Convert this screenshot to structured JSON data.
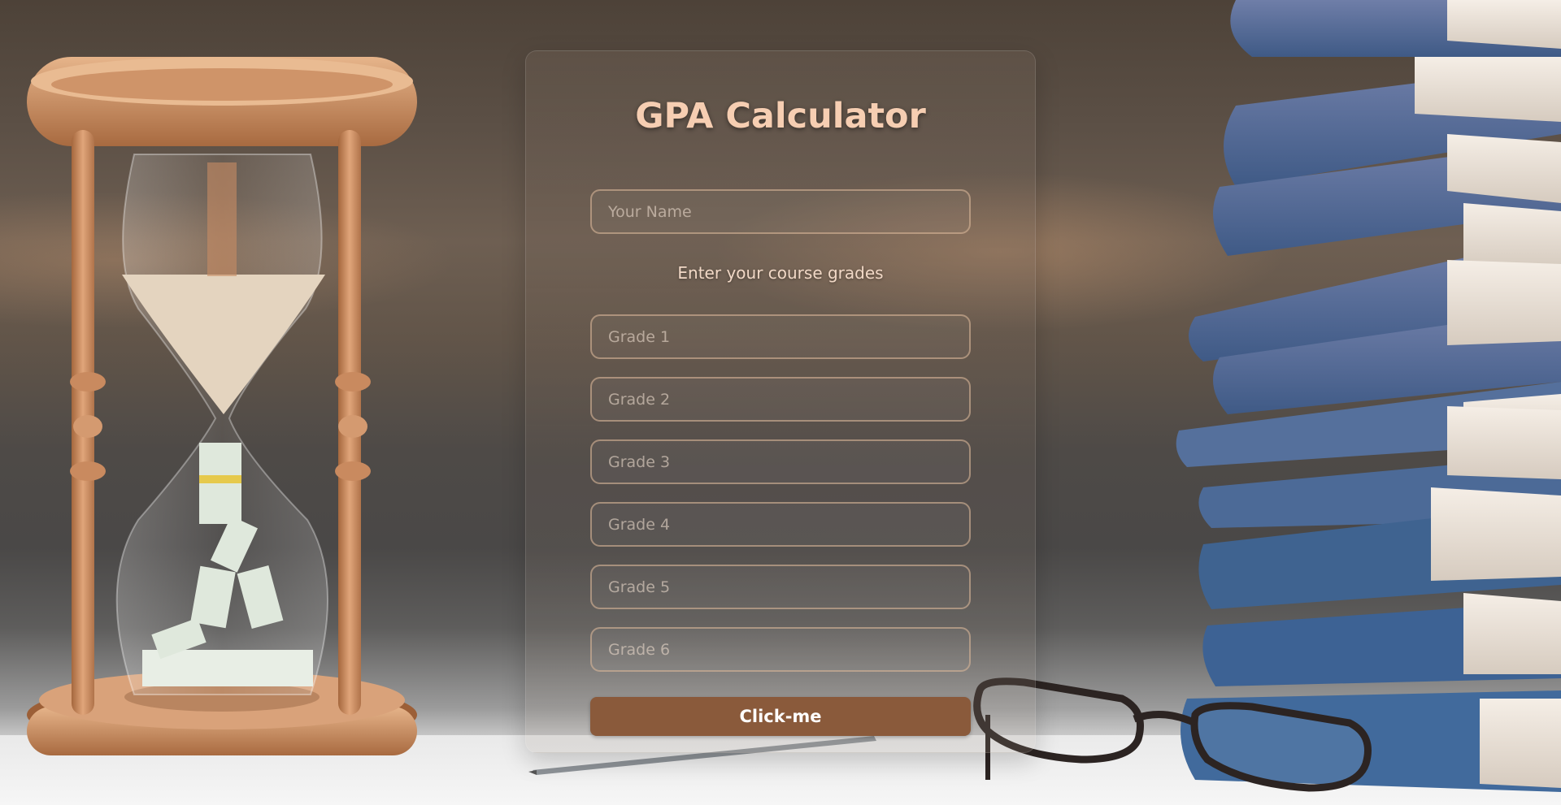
{
  "form": {
    "title": "GPA Calculator",
    "name_placeholder": "Your Name",
    "grades_hint": "Enter your course grades",
    "grade_placeholders": [
      "Grade 1",
      "Grade 2",
      "Grade 3",
      "Grade 4",
      "Grade 5",
      "Grade 6"
    ],
    "submit_label": "Click-me"
  },
  "colors": {
    "title": "#f6ceb2",
    "button": "#8a5a3b",
    "field_border": "#d7b496"
  },
  "decor": [
    "hourglass-image",
    "book-stack-image",
    "eyeglasses-image",
    "pen-image"
  ]
}
